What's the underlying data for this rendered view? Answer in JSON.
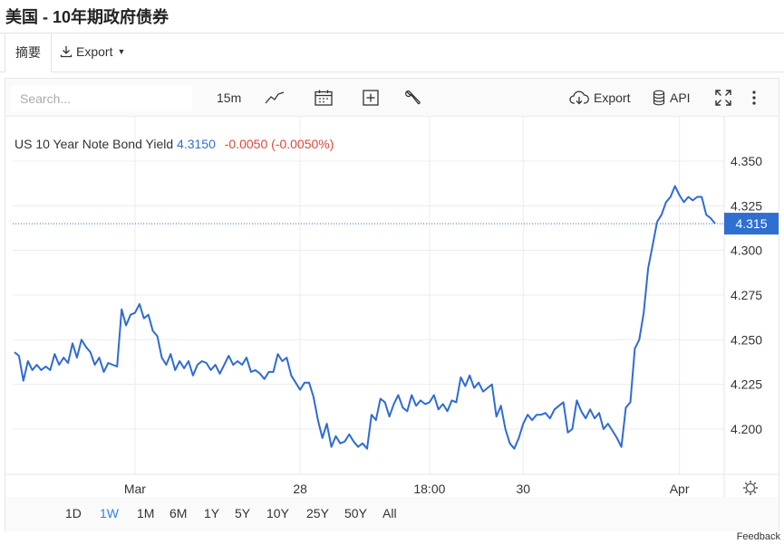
{
  "page": {
    "title": "美国 - 10年期政府债券"
  },
  "tabs": {
    "summary_label": "摘要",
    "export_label": "Export"
  },
  "toolbar": {
    "search_placeholder": "Search...",
    "interval_label": "15m",
    "export_label": "Export",
    "api_label": "API"
  },
  "legend": {
    "symbol_label": "US 10 Year Note Bond Yield",
    "last_value": "4.3150",
    "change": "-0.0050 (-0.0050%)",
    "value_color": "#2f6fd1",
    "change_color": "#e0463a"
  },
  "price_badge": {
    "label": "4.315",
    "color": "#2f6fd1"
  },
  "range_buttons": [
    {
      "label": "1D",
      "active": false
    },
    {
      "label": "1W",
      "active": true
    },
    {
      "label": "1M",
      "active": false
    },
    {
      "label": "6M",
      "active": false
    },
    {
      "label": "1Y",
      "active": false
    },
    {
      "label": "5Y",
      "active": false
    },
    {
      "label": "10Y",
      "active": false
    },
    {
      "label": "25Y",
      "active": false
    },
    {
      "label": "50Y",
      "active": false
    },
    {
      "label": "All",
      "active": false
    }
  ],
  "feedback_label": "Feedback",
  "chart_data": {
    "type": "line",
    "title": "",
    "xlabel": "",
    "ylabel": "",
    "series_color": "#2f6bd4",
    "y_axis": {
      "ticks": [
        4.2,
        4.225,
        4.25,
        4.275,
        4.3,
        4.325,
        4.35
      ],
      "tick_labels": [
        "4.200",
        "4.225",
        "4.250",
        "4.275",
        "4.300",
        "4.325",
        "4.350"
      ],
      "position": "right"
    },
    "current_value": 4.315,
    "x_range": [
      0,
      157
    ],
    "x_ticks": [
      {
        "x": 27,
        "label": "Mar"
      },
      {
        "x": 64,
        "label": "28"
      },
      {
        "x": 93,
        "label": "18:00"
      },
      {
        "x": 114,
        "label": "30"
      },
      {
        "x": 149,
        "label": "Apr"
      }
    ],
    "grid": true,
    "points": [
      [
        0,
        4.243
      ],
      [
        1,
        4.241
      ],
      [
        2,
        4.227
      ],
      [
        3,
        4.238
      ],
      [
        4,
        4.233
      ],
      [
        5,
        4.236
      ],
      [
        6,
        4.233
      ],
      [
        7,
        4.235
      ],
      [
        8,
        4.233
      ],
      [
        9,
        4.242
      ],
      [
        10,
        4.236
      ],
      [
        11,
        4.24
      ],
      [
        12,
        4.237
      ],
      [
        13,
        4.248
      ],
      [
        14,
        4.24
      ],
      [
        15,
        4.25
      ],
      [
        16,
        4.246
      ],
      [
        17,
        4.243
      ],
      [
        18,
        4.236
      ],
      [
        19,
        4.24
      ],
      [
        20,
        4.232
      ],
      [
        21,
        4.237
      ],
      [
        22,
        4.236
      ],
      [
        23,
        4.235
      ],
      [
        24,
        4.267
      ],
      [
        25,
        4.258
      ],
      [
        26,
        4.264
      ],
      [
        27,
        4.265
      ],
      [
        28,
        4.27
      ],
      [
        29,
        4.262
      ],
      [
        30,
        4.264
      ],
      [
        31,
        4.255
      ],
      [
        32,
        4.252
      ],
      [
        33,
        4.24
      ],
      [
        34,
        4.236
      ],
      [
        35,
        4.242
      ],
      [
        36,
        4.233
      ],
      [
        37,
        4.238
      ],
      [
        38,
        4.234
      ],
      [
        39,
        4.238
      ],
      [
        40,
        4.23
      ],
      [
        41,
        4.236
      ],
      [
        42,
        4.238
      ],
      [
        43,
        4.237
      ],
      [
        44,
        4.233
      ],
      [
        45,
        4.236
      ],
      [
        46,
        4.231
      ],
      [
        47,
        4.236
      ],
      [
        48,
        4.241
      ],
      [
        49,
        4.236
      ],
      [
        50,
        4.238
      ],
      [
        51,
        4.236
      ],
      [
        52,
        4.24
      ],
      [
        53,
        4.232
      ],
      [
        54,
        4.233
      ],
      [
        55,
        4.231
      ],
      [
        56,
        4.228
      ],
      [
        57,
        4.232
      ],
      [
        58,
        4.232
      ],
      [
        59,
        4.242
      ],
      [
        60,
        4.238
      ],
      [
        61,
        4.24
      ],
      [
        62,
        4.23
      ],
      [
        63,
        4.226
      ],
      [
        64,
        4.222
      ],
      [
        65,
        4.226
      ],
      [
        66,
        4.226
      ],
      [
        67,
        4.218
      ],
      [
        68,
        4.205
      ],
      [
        69,
        4.195
      ],
      [
        70,
        4.203
      ],
      [
        71,
        4.19
      ],
      [
        72,
        4.196
      ],
      [
        73,
        4.192
      ],
      [
        74,
        4.193
      ],
      [
        75,
        4.197
      ],
      [
        76,
        4.193
      ],
      [
        77,
        4.19
      ],
      [
        78,
        4.192
      ],
      [
        79,
        4.189
      ],
      [
        80,
        4.208
      ],
      [
        81,
        4.205
      ],
      [
        82,
        4.217
      ],
      [
        83,
        4.215
      ],
      [
        84,
        4.207
      ],
      [
        85,
        4.214
      ],
      [
        86,
        4.219
      ],
      [
        87,
        4.212
      ],
      [
        88,
        4.21
      ],
      [
        89,
        4.219
      ],
      [
        90,
        4.213
      ],
      [
        91,
        4.216
      ],
      [
        92,
        4.214
      ],
      [
        93,
        4.215
      ],
      [
        94,
        4.219
      ],
      [
        95,
        4.211
      ],
      [
        96,
        4.214
      ],
      [
        97,
        4.21
      ],
      [
        98,
        4.216
      ],
      [
        99,
        4.215
      ],
      [
        100,
        4.229
      ],
      [
        101,
        4.224
      ],
      [
        102,
        4.23
      ],
      [
        103,
        4.223
      ],
      [
        104,
        4.226
      ],
      [
        105,
        4.221
      ],
      [
        106,
        4.223
      ],
      [
        107,
        4.225
      ],
      [
        108,
        4.207
      ],
      [
        109,
        4.213
      ],
      [
        110,
        4.2
      ],
      [
        111,
        4.192
      ],
      [
        112,
        4.189
      ],
      [
        113,
        4.195
      ],
      [
        114,
        4.203
      ],
      [
        115,
        4.208
      ],
      [
        116,
        4.205
      ],
      [
        117,
        4.208
      ],
      [
        118,
        4.208
      ],
      [
        119,
        4.209
      ],
      [
        120,
        4.206
      ],
      [
        121,
        4.211
      ],
      [
        122,
        4.213
      ],
      [
        123,
        4.215
      ],
      [
        124,
        4.198
      ],
      [
        125,
        4.2
      ],
      [
        126,
        4.216
      ],
      [
        127,
        4.21
      ],
      [
        128,
        4.206
      ],
      [
        129,
        4.211
      ],
      [
        130,
        4.206
      ],
      [
        131,
        4.209
      ],
      [
        132,
        4.2
      ],
      [
        133,
        4.203
      ],
      [
        134,
        4.199
      ],
      [
        135,
        4.195
      ],
      [
        136,
        4.19
      ],
      [
        137,
        4.212
      ],
      [
        138,
        4.215
      ],
      [
        139,
        4.245
      ],
      [
        140,
        4.25
      ],
      [
        141,
        4.265
      ],
      [
        142,
        4.29
      ],
      [
        143,
        4.303
      ],
      [
        144,
        4.316
      ],
      [
        145,
        4.32
      ],
      [
        146,
        4.327
      ],
      [
        147,
        4.33
      ],
      [
        148,
        4.336
      ],
      [
        149,
        4.331
      ],
      [
        150,
        4.327
      ],
      [
        151,
        4.33
      ],
      [
        152,
        4.328
      ],
      [
        153,
        4.33
      ],
      [
        154,
        4.33
      ],
      [
        155,
        4.32
      ],
      [
        156,
        4.318
      ],
      [
        157,
        4.315
      ]
    ]
  }
}
